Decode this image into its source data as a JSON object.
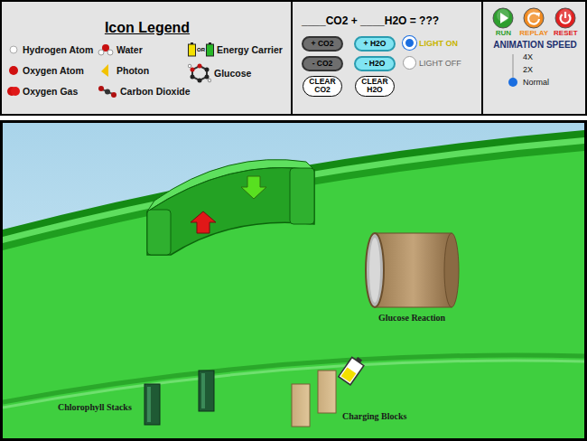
{
  "legend": {
    "title": "Icon Legend",
    "columns": [
      [
        {
          "label": "Hydrogen Atom",
          "kind": "hydrogen"
        },
        {
          "label": "Oxygen Atom",
          "kind": "oxygen-atom"
        },
        {
          "label": "Oxygen Gas",
          "kind": "oxygen-gas"
        }
      ],
      [
        {
          "label": "Water",
          "kind": "water"
        },
        {
          "label": "Photon",
          "kind": "photon"
        },
        {
          "label": "Carbon Dioxide",
          "kind": "carbon-dioxide"
        }
      ],
      [
        {
          "label": "Energy Carrier",
          "kind": "energy-carrier",
          "icon_text": "OR"
        },
        {
          "label": "Glucose",
          "kind": "glucose"
        }
      ]
    ]
  },
  "equation": "____CO2 + ____H2O = ???",
  "co2_buttons": [
    {
      "label": "+ CO2",
      "kind": "add"
    },
    {
      "label": "- CO2",
      "kind": "remove"
    },
    {
      "label": "CLEAR CO2",
      "kind": "clear"
    }
  ],
  "h2o_buttons": [
    {
      "label": "+ H2O",
      "kind": "add"
    },
    {
      "label": "- H2O",
      "kind": "remove"
    },
    {
      "label": "CLEAR H2O",
      "kind": "clear"
    }
  ],
  "light": [
    {
      "label": "LIGHT ON",
      "selected": true
    },
    {
      "label": "LIGHT OFF",
      "selected": false
    }
  ],
  "controls": [
    {
      "label": "RUN",
      "kind": "run",
      "color": "#2e9e2e"
    },
    {
      "label": "REPLAY",
      "kind": "replay",
      "color": "#f08a20"
    },
    {
      "label": "RESET",
      "kind": "reset",
      "color": "#e02020"
    }
  ],
  "speed": {
    "title": "ANIMATION SPEED",
    "options": [
      {
        "label": "4X",
        "selected": false
      },
      {
        "label": "2X",
        "selected": false
      },
      {
        "label": "Normal",
        "selected": true
      }
    ]
  },
  "scene": {
    "glucose_reaction": "Glucose Reaction",
    "chlorophyll_stacks": "Chlorophyll Stacks",
    "charging_blocks": "Charging Blocks"
  }
}
